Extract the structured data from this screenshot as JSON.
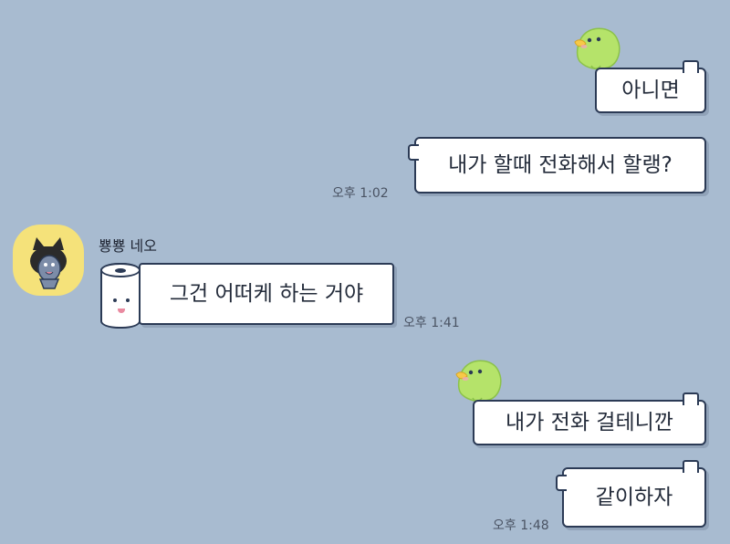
{
  "messages_out": [
    {
      "text": "아니면"
    },
    {
      "text": "내가 할때 전화해서 할랭?",
      "time": "오후 1:02"
    },
    {
      "text": "내가 전화 걸테니깐"
    },
    {
      "text": "같이하자",
      "time": "오후 1:48"
    }
  ],
  "message_in": {
    "sender": "뿅뿅 네오",
    "text": "그건 어떠케 하는 거야",
    "time": "오후 1:41"
  },
  "colors": {
    "background": "#a8bbd0",
    "bubble": "#ffffff",
    "outline": "#2b3a55",
    "bird_green": "#b5e36a",
    "avatar_bg": "#f5e27a"
  }
}
